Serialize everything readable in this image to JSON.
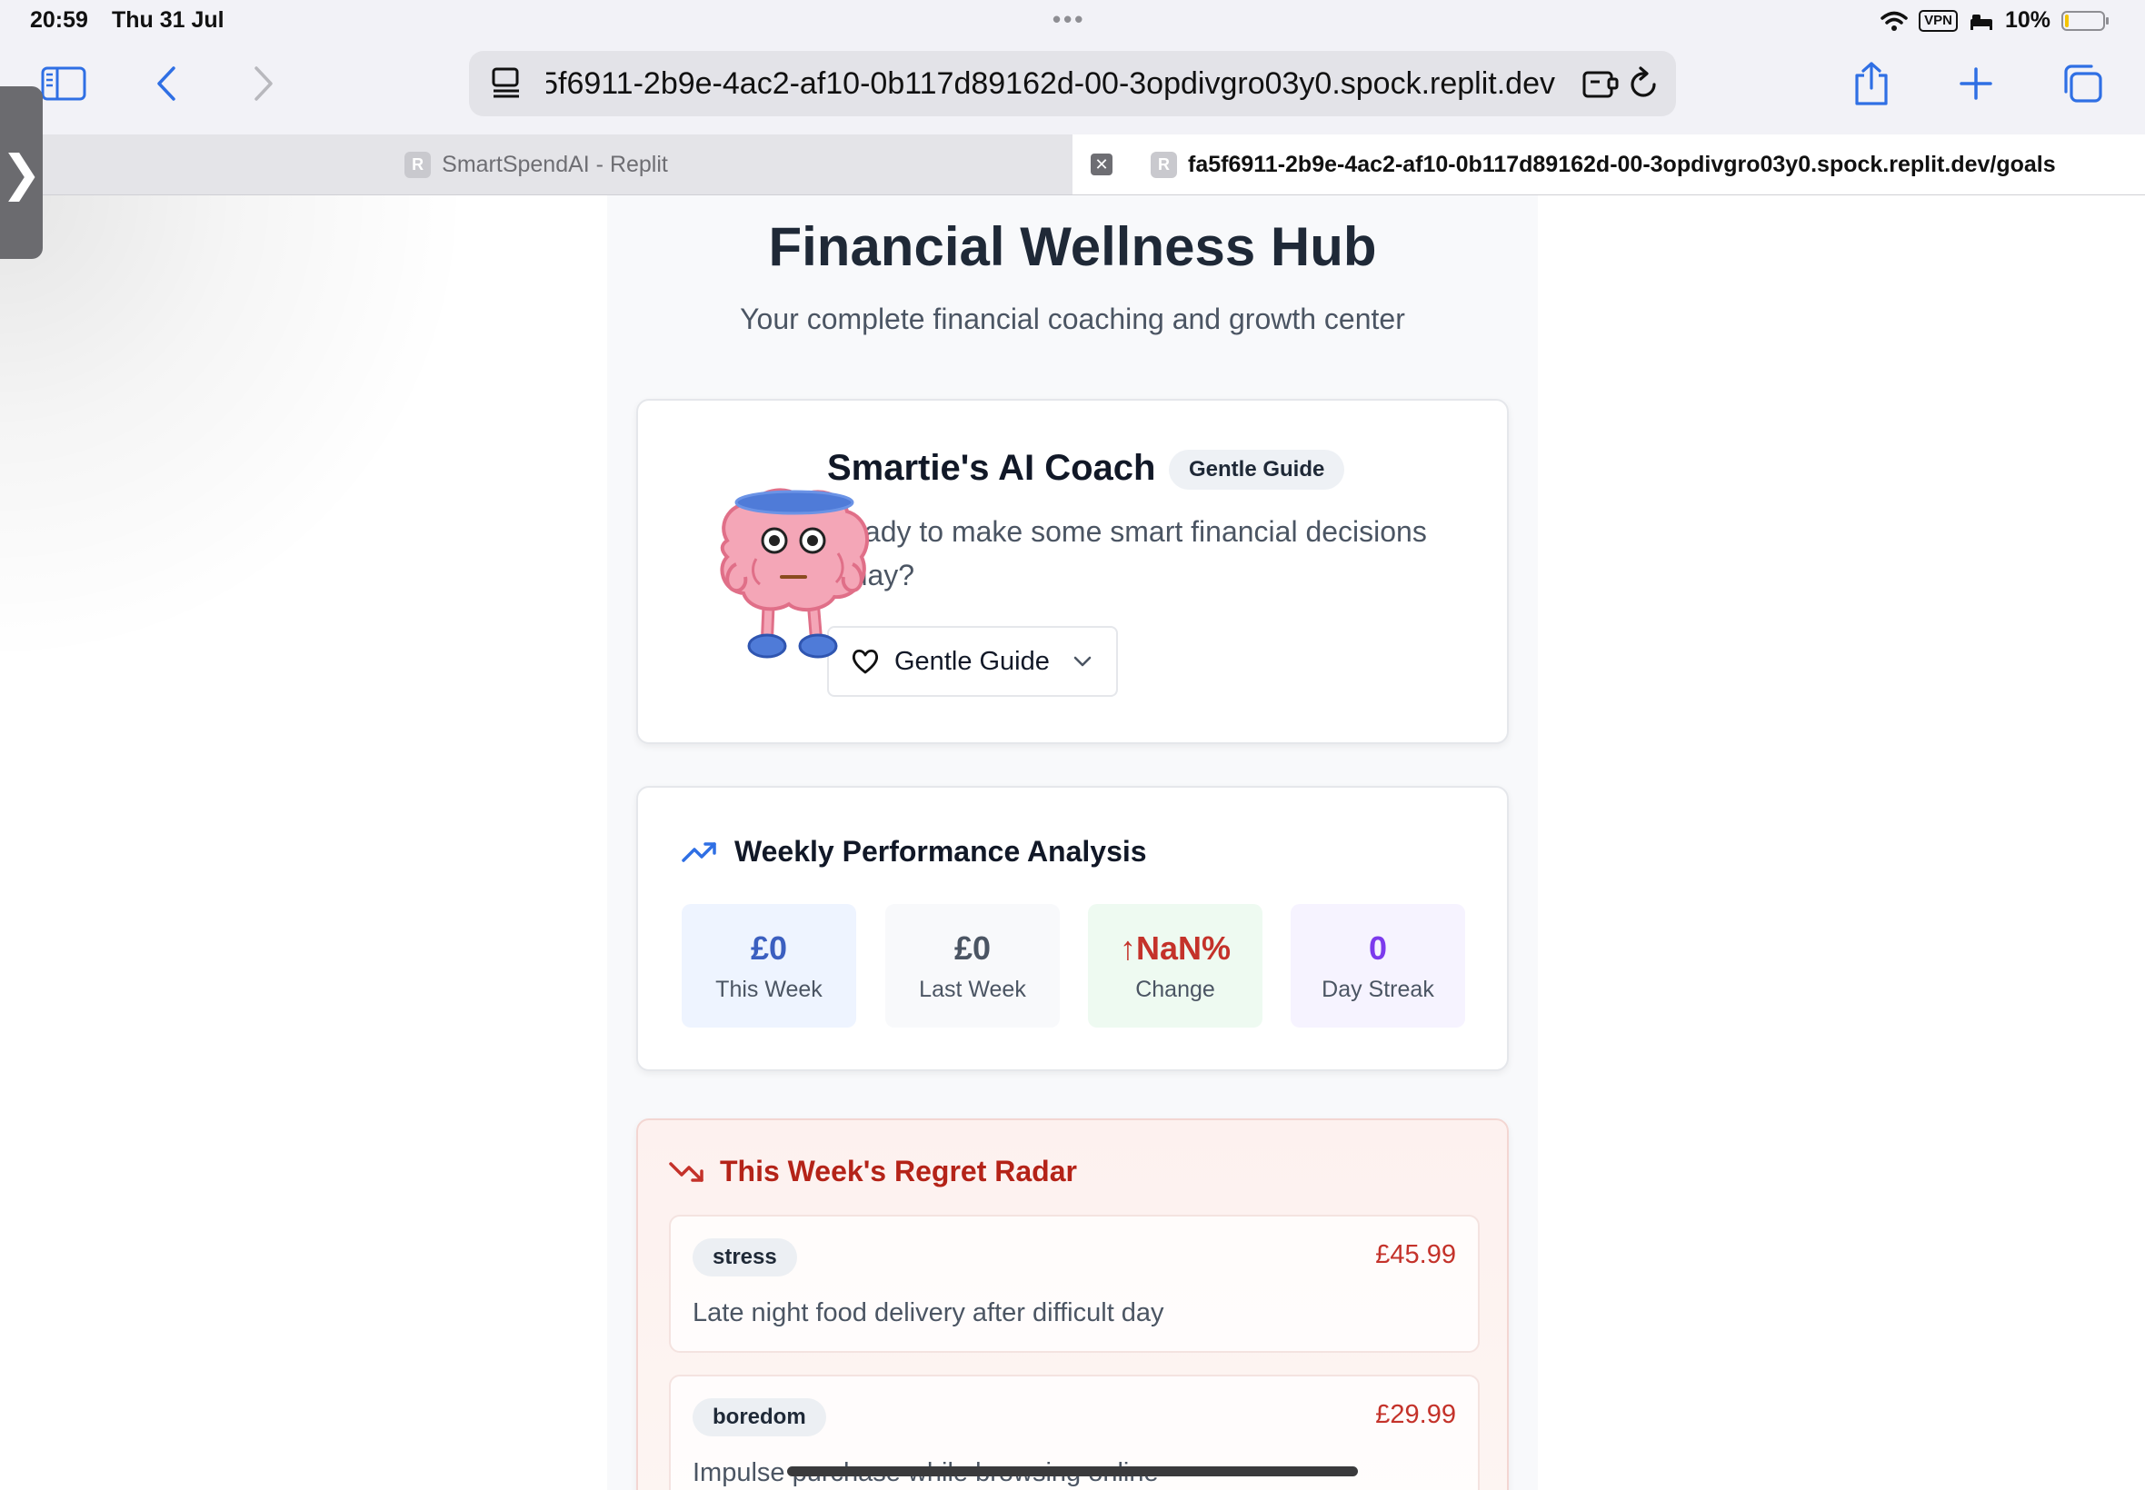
{
  "status_bar": {
    "time": "20:59",
    "date": "Thu 31 Jul",
    "vpn": "VPN",
    "battery": "10%",
    "battery_level": 0.1
  },
  "toolbar": {
    "url": "fa5f6911-2b9e-4ac2-af10-0b117d89162d-00-3opdivgro03y0.spock.replit.dev",
    "icons": [
      "sidebar-icon",
      "back-icon",
      "forward-icon",
      "page-menu-icon",
      "extension-icon",
      "reload-icon",
      "share-icon",
      "new-tab-icon",
      "tabs-overview-icon"
    ]
  },
  "tabs": [
    {
      "favicon": "R",
      "title": "SmartSpendAI - Replit",
      "active": false
    },
    {
      "favicon": "R",
      "title": "fa5f6911-2b9e-4ac2-af10-0b117d89162d-00-3opdivgro03y0.spock.replit.dev/goals",
      "active": true
    }
  ],
  "side_handle": "❯",
  "page": {
    "title": "Financial Wellness Hub",
    "subtitle": "Your complete financial coaching and growth center"
  },
  "coach": {
    "title": "Smartie's AI Coach",
    "badge": "Gentle Guide",
    "message": "Ready to make some smart financial decisions today?",
    "select_label": "Gentle Guide",
    "select_icon": "heart-icon"
  },
  "weekly": {
    "title": "Weekly Performance Analysis",
    "icon": "trending-up-icon",
    "stats": [
      {
        "value": "£0",
        "label": "This Week",
        "color": "#3b5fc0",
        "bg": "#eef4ff"
      },
      {
        "value": "£0",
        "label": "Last Week",
        "color": "#4b5563",
        "bg": "#f8f9fb"
      },
      {
        "value": "↑NaN%",
        "label": "Change",
        "color": "#c4322a",
        "bg": "#eefaf1"
      },
      {
        "value": "0",
        "label": "Day Streak",
        "color": "#7c3aed",
        "bg": "#f6f3ff"
      }
    ]
  },
  "regret": {
    "title": "This Week's Regret Radar",
    "icon": "trending-down-icon",
    "items": [
      {
        "tag": "stress",
        "amount": "£45.99",
        "description": "Late night food delivery after difficult day"
      },
      {
        "tag": "boredom",
        "amount": "£29.99",
        "description": "Impulse purchase while browsing online"
      }
    ]
  },
  "colors": {
    "accent_blue": "#2f6fe4",
    "danger_red": "#c4322a"
  }
}
